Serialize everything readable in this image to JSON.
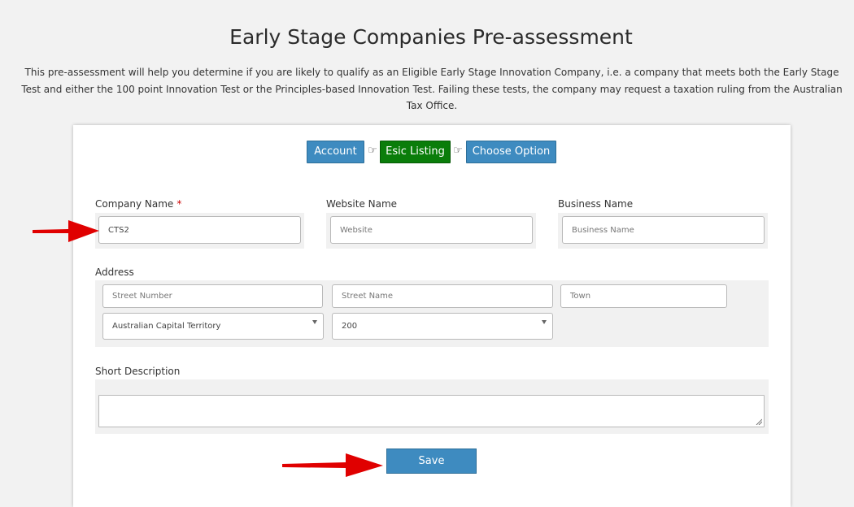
{
  "page": {
    "title": "Early Stage Companies Pre-assessment",
    "intro": "This pre-assessment will help you determine if you are likely to qualify as an Eligible Early Stage Innovation Company, i.e. a company that meets both the Early Stage Test and either the 100 point Innovation Test or the Principles-based Innovation Test. Failing these tests, the company may request a taxation ruling from the Australian Tax Office."
  },
  "steps": {
    "account": "Account",
    "esic_listing": "Esic Listing",
    "choose_option": "Choose Option",
    "separator_icon": "hand-pointing-right-icon"
  },
  "form": {
    "company_name": {
      "label": "Company Name",
      "required_mark": "*",
      "value": "CTS2"
    },
    "website_name": {
      "label": "Website Name",
      "placeholder": "Website"
    },
    "business_name": {
      "label": "Business Name",
      "placeholder": "Business Name"
    },
    "address": {
      "label": "Address",
      "street_number_placeholder": "Street Number",
      "street_name_placeholder": "Street Name",
      "town_placeholder": "Town",
      "state_selected": "Australian Capital Territory",
      "postcode_selected": "200"
    },
    "short_description": {
      "label": "Short Description",
      "value": ""
    },
    "save_label": "Save"
  },
  "colors": {
    "step_blue": "#3e8bc0",
    "step_green": "#0a7d0a",
    "required": "#cc0000",
    "annotation_arrow": "#e00000"
  }
}
